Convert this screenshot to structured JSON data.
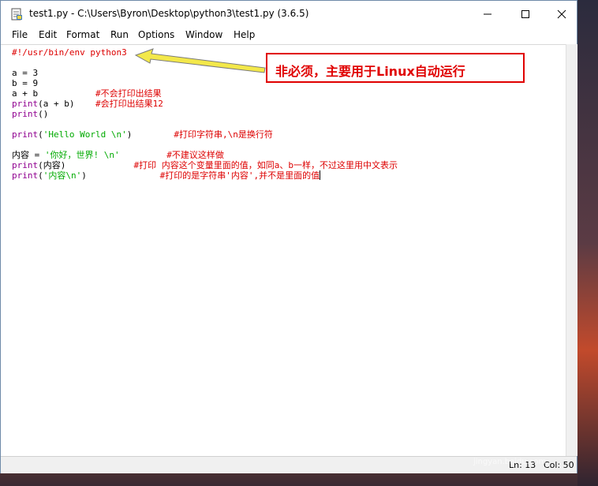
{
  "window": {
    "title": "test1.py - C:\\Users\\Byron\\Desktop\\python3\\test1.py (3.6.5)"
  },
  "menu": {
    "items": [
      "File",
      "Edit",
      "Format",
      "Run",
      "Options",
      "Window",
      "Help"
    ]
  },
  "code": {
    "l1": "#!/usr/bin/env python3",
    "l3": "a = 3",
    "l4": "b = 9",
    "l5_code": "a + b           ",
    "l5_comment": "#不会打印出结果",
    "l6_kw": "print",
    "l6_code": "(a + b)    ",
    "l6_comment": "#会打印出结果12",
    "l7_kw": "print",
    "l7_code": "()",
    "l9_kw": "print",
    "l9_code": "(",
    "l9_str": "'Hello World \\n'",
    "l9_code2": ")        ",
    "l9_comment": "#打印字符串,\\n是换行符",
    "l11_code": "内容 = ",
    "l11_str": "'你好，世界! \\n'",
    "l11_pad": "         ",
    "l11_comment": "#不建议这样做",
    "l12_kw": "print",
    "l12_code": "(内容)             ",
    "l12_comment": "#打印 内容这个变量里面的值，如同a、b一样，不过这里用中文表示",
    "l13_kw": "print",
    "l13_code": "(",
    "l13_str": "'内容\\n'",
    "l13_code2": ")              ",
    "l13_comment": "#打印的是字符串'内容',并不是里面的值"
  },
  "status": {
    "line": "Ln: 13",
    "col": "Col: 50"
  },
  "annotation": {
    "text": "非必须，主要用于Linux自动运行"
  },
  "watermark": {
    "text": "Bai 经验",
    "sub": "jingyan.baidu.com"
  },
  "colors": {
    "keyword": "#900090",
    "string": "#00aa00",
    "comment": "#dd0000",
    "callout_border": "#e00000"
  }
}
